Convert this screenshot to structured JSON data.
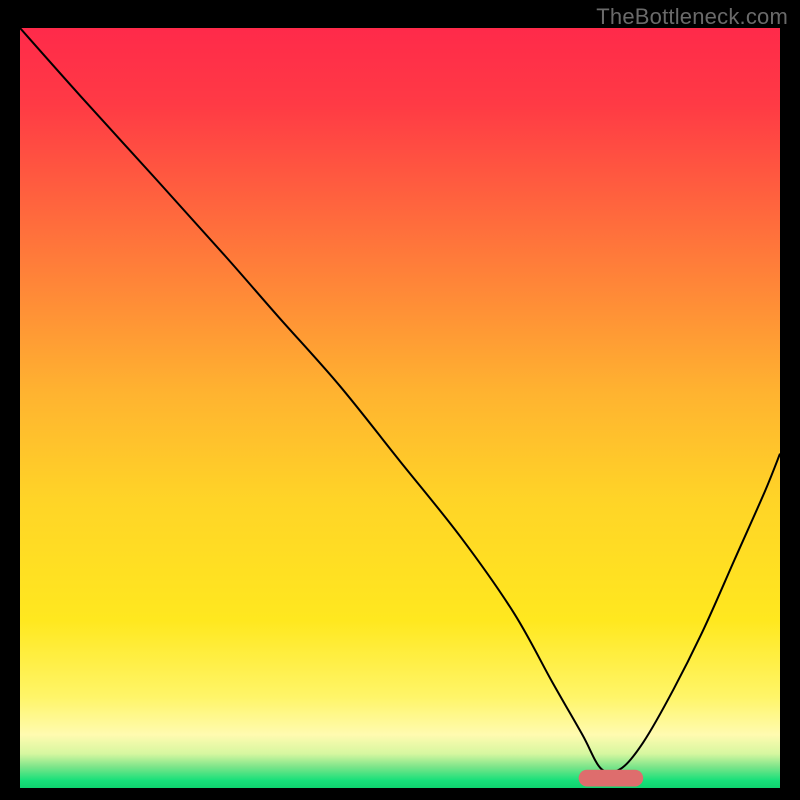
{
  "watermark": "TheBottleneck.com",
  "chart_data": {
    "type": "line",
    "title": "",
    "xlabel": "",
    "ylabel": "",
    "xlim": [
      0,
      100
    ],
    "ylim": [
      0,
      100
    ],
    "grid": false,
    "legend": false,
    "background_gradient": {
      "type": "vertical",
      "stops": [
        {
          "pos": 0.0,
          "color": "#ff2a4a"
        },
        {
          "pos": 0.1,
          "color": "#ff3a45"
        },
        {
          "pos": 0.3,
          "color": "#ff7a3a"
        },
        {
          "pos": 0.48,
          "color": "#ffb330"
        },
        {
          "pos": 0.62,
          "color": "#ffd427"
        },
        {
          "pos": 0.78,
          "color": "#ffe81f"
        },
        {
          "pos": 0.88,
          "color": "#fff568"
        },
        {
          "pos": 0.93,
          "color": "#fffbb0"
        },
        {
          "pos": 0.955,
          "color": "#d6f7a0"
        },
        {
          "pos": 0.972,
          "color": "#7de58a"
        },
        {
          "pos": 0.99,
          "color": "#17e07a"
        },
        {
          "pos": 1.0,
          "color": "#0fd36f"
        }
      ]
    },
    "series": [
      {
        "name": "bottleneck-curve",
        "color": "#000000",
        "stroke_width": 2,
        "x": [
          0,
          8,
          18,
          27,
          34,
          42,
          50,
          58,
          65,
          70,
          74,
          76.5,
          79,
          82,
          86,
          90,
          94,
          98,
          100
        ],
        "y": [
          100,
          91,
          80,
          70,
          62,
          53,
          43,
          33,
          23,
          14,
          7,
          2.5,
          2.5,
          6,
          13,
          21,
          30,
          39,
          44
        ]
      }
    ],
    "marker": {
      "name": "optimal-range",
      "shape": "rounded-bar",
      "color": "#de6d6d",
      "x_start": 73.5,
      "x_end": 82,
      "y": 1.3,
      "height": 2.2
    }
  }
}
